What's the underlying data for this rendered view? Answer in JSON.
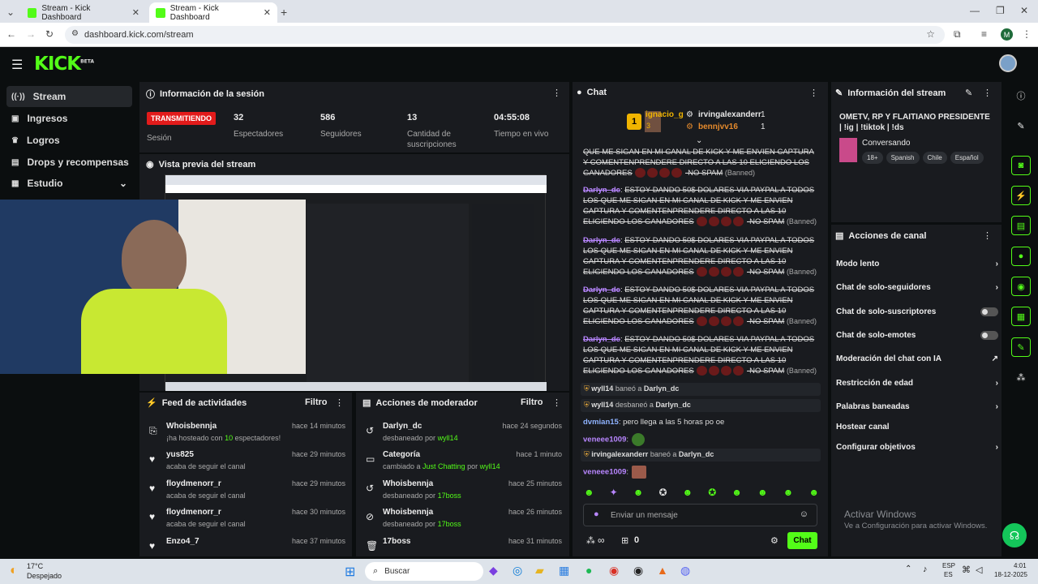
{
  "browser": {
    "tabs": [
      {
        "title": "Stream - Kick Dashboard"
      },
      {
        "title": "Stream - Kick Dashboard"
      }
    ],
    "url": "dashboard.kick.com/stream",
    "profile_initial": "M"
  },
  "brand": {
    "logo": "KICK",
    "beta": "BETA",
    "accent": "#53fc18"
  },
  "sidebar": {
    "items": [
      {
        "label": "Stream",
        "icon": "broadcast-icon",
        "active": true
      },
      {
        "label": "Ingresos",
        "icon": "money-icon"
      },
      {
        "label": "Logros",
        "icon": "trophy-icon"
      },
      {
        "label": "Drops y recompensas",
        "icon": "gift-icon"
      },
      {
        "label": "Estudio",
        "icon": "studio-icon"
      }
    ]
  },
  "session": {
    "title": "Información de la sesión",
    "status_badge": "TRANSMITIENDO",
    "status_label": "Sesión",
    "stats": [
      {
        "value": "32",
        "label": "Espectadores"
      },
      {
        "value": "586",
        "label": "Seguidores"
      },
      {
        "value": "13",
        "label": "Cantidad de suscripciones"
      },
      {
        "value": "04:55:08",
        "label": "Tiempo en vivo"
      }
    ]
  },
  "preview": {
    "title": "Vista previa del stream"
  },
  "activity_feed": {
    "title": "Feed de actividades",
    "filter_label": "Filtro",
    "rows": [
      {
        "name": "Whoisbennja",
        "sub_pre": "¡ha hosteado con ",
        "sub_hl": "10",
        "sub_post": " espectadores!",
        "time": "hace 14 minutos",
        "icon": "host-icon"
      },
      {
        "name": "yus825",
        "sub_pre": "acaba de seguir el canal",
        "sub_hl": "",
        "sub_post": "",
        "time": "hace 29 minutos",
        "icon": "heart-icon"
      },
      {
        "name": "floydmenorr_r",
        "sub_pre": "acaba de seguir el canal",
        "sub_hl": "",
        "sub_post": "",
        "time": "hace 29 minutos",
        "icon": "heart-icon"
      },
      {
        "name": "floydmenorr_r",
        "sub_pre": "acaba de seguir el canal",
        "sub_hl": "",
        "sub_post": "",
        "time": "hace 30 minutos",
        "icon": "heart-icon"
      },
      {
        "name": "Enzo4_7",
        "sub_pre": "",
        "sub_hl": "",
        "sub_post": "",
        "time": "hace 37 minutos",
        "icon": "heart-icon"
      }
    ]
  },
  "mod_actions": {
    "title": "Acciones de moderador",
    "filter_label": "Filtro",
    "rows": [
      {
        "name": "Darlyn_dc",
        "sub_pre": "desbaneado por ",
        "sub_hl": "wyll14",
        "sub_mid": "",
        "sub_hl2": "",
        "time": "hace 24 segundos",
        "icon": "undo-icon"
      },
      {
        "name": "Categoría",
        "sub_pre": "cambiado a ",
        "sub_hl": "Just Chatting",
        "sub_mid": " por ",
        "sub_hl2": "wyll14",
        "time": "hace 1 minuto",
        "icon": "category-icon"
      },
      {
        "name": "Whoisbennja",
        "sub_pre": "desbaneado por ",
        "sub_hl": "17boss",
        "sub_mid": "",
        "sub_hl2": "",
        "time": "hace 25 minutos",
        "icon": "undo-icon"
      },
      {
        "name": "Whoisbennja",
        "sub_pre": "desbaneado por ",
        "sub_hl": "17boss",
        "sub_mid": "",
        "sub_hl2": "",
        "time": "hace 26 minutos",
        "icon": "ban-icon"
      },
      {
        "name": "17boss",
        "sub_pre": "",
        "sub_hl": "",
        "sub_mid": "",
        "sub_hl2": "",
        "time": "hace 31 minutos",
        "icon": "trash-icon"
      }
    ]
  },
  "chat": {
    "title": "Chat",
    "leaders": [
      {
        "name": "ignacio_g",
        "count": "3"
      },
      {
        "name": "irvingalexanderr",
        "count": "1"
      },
      {
        "name": "bennjvv16",
        "count": "1"
      }
    ],
    "first_msg": "QUE ME SIGAN EN MI CANAL DE KICK Y ME ENVIEN CAPTURA Y COMENTENPRENDERE DIRECTO A LAS 10 ELIGIENDO LOS GANADORES",
    "spam_user": "Darlyn_dc",
    "spam_text": "ESTOY DANDO 50$ DOLARES VIA PAYPAL A TODOS LOS QUE ME SIGAN EN MI CANAL DE KICK Y ME ENVIEN CAPTURA Y COMENTENPRENDERE DIRECTO A LAS 10 ELIGIENDO LOS GANADORES",
    "spam_tail": "-NO SPAM",
    "banned_tag": "(Banned)",
    "events": [
      {
        "actor": "wyll14",
        "verb": " baneó a ",
        "target": "Darlyn_dc"
      },
      {
        "actor": "wyll14",
        "verb": " desbaneó a ",
        "target": "Darlyn_dc"
      }
    ],
    "msg_dvmian_user": "dvmian15",
    "msg_dvmian_text": ": pero llega a las 5 horas po oe",
    "veneee_user": "veneee1009",
    "irving_event": {
      "actor": "irvingalexanderr",
      "verb": " baneó a ",
      "target": "Darlyn_dc"
    },
    "input_placeholder": "Enviar un mensaje",
    "viewer_count": "0",
    "infinity": "∞",
    "send_label": "Chat"
  },
  "stream_info": {
    "title": "Información del stream",
    "stream_title": "OMETV, RP Y FLAITIANO PRESIDENTE | !ig | !tiktok | !ds",
    "category": "Conversando",
    "tags": [
      "18+",
      "Spanish",
      "Chile",
      "Español"
    ]
  },
  "channel_actions": {
    "title": "Acciones de canal",
    "items": [
      {
        "label": "Modo lento",
        "control": "chevron"
      },
      {
        "label": "Chat de solo-seguidores",
        "control": "chevron"
      },
      {
        "label": "Chat de solo-suscriptores",
        "control": "toggle"
      },
      {
        "label": "Chat de solo-emotes",
        "control": "toggle"
      },
      {
        "label": "Moderación del chat con IA",
        "control": "external"
      },
      {
        "label": "Restricción de edad",
        "control": "chevron"
      },
      {
        "label": "Palabras baneadas",
        "control": "chevron"
      },
      {
        "label": "Hostear canal",
        "control": "none"
      },
      {
        "label": "Configurar objetivos",
        "control": "chevron"
      }
    ]
  },
  "windows_watermark": {
    "line1": "Activar Windows",
    "line2": "Ve a Configuración para activar Windows."
  },
  "taskbar": {
    "weather_temp": "17°C",
    "weather_desc": "Despejado",
    "search_placeholder": "Buscar",
    "lang1": "ESP",
    "lang2": "ES",
    "time": "4:01",
    "date": "18-12-2025"
  }
}
